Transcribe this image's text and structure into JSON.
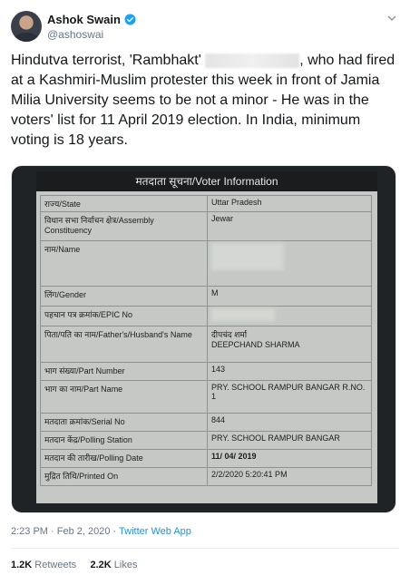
{
  "author": {
    "name": "Ashok Swain",
    "handle": "@ashoswai"
  },
  "tweet": {
    "text_before": "Hindutva terrorist, 'Rambhakt'",
    "text_after": ", who had fired at a Kashmiri-Muslim protester this week in front of Jamia Milia University seems to be not a minor - He was in the voters' list for 11 April 2019 election. In India, minimum voting is 18 years."
  },
  "voter_card": {
    "header": "मतदाता सूचना/Voter Information",
    "rows": [
      {
        "label": "राज्य/State",
        "value": "Uttar Pradesh"
      },
      {
        "label": "विधान सभा निर्वाचन क्षेत्र/Assembly Constituency",
        "value": "Jewar"
      },
      {
        "label": "नाम/Name",
        "value": ""
      },
      {
        "label": "लिंग/Gender",
        "value": "M"
      },
      {
        "label": "पहचान पत्र क्रमांक/EPIC No",
        "value": ""
      },
      {
        "label": "पिता/पति का नाम/Father's/Husband's Name",
        "value": "दीपचंद शर्मा\nDEEPCHAND SHARMA"
      },
      {
        "label": "भाग संख्या/Part Number",
        "value": "143"
      },
      {
        "label": "भाग का नाम/Part Name",
        "value": "PRY. SCHOOL RAMPUR BANGAR R.NO. 1"
      },
      {
        "label": "मतदाता क्रमांक/Serial No",
        "value": "844"
      },
      {
        "label": "मतदान केंद्र/Polling Station",
        "value": "PRY. SCHOOL RAMPUR BANGAR"
      },
      {
        "label": "मतदान की तारीख/Polling Date",
        "value": "11/ 04/ 2019"
      },
      {
        "label": "मुद्रित तिथि/Printed On",
        "value": "2/2/2020 5:20:41 PM"
      }
    ]
  },
  "meta": {
    "time": "2:23 PM · Feb 2, 2020 · ",
    "source": "Twitter Web App"
  },
  "stats": {
    "retweets_count": "1.2K",
    "retweets_label": " Retweets",
    "likes_count": "2.2K",
    "likes_label": " Likes"
  },
  "icons": [
    "verified-badge-icon",
    "chevron-down-icon"
  ]
}
